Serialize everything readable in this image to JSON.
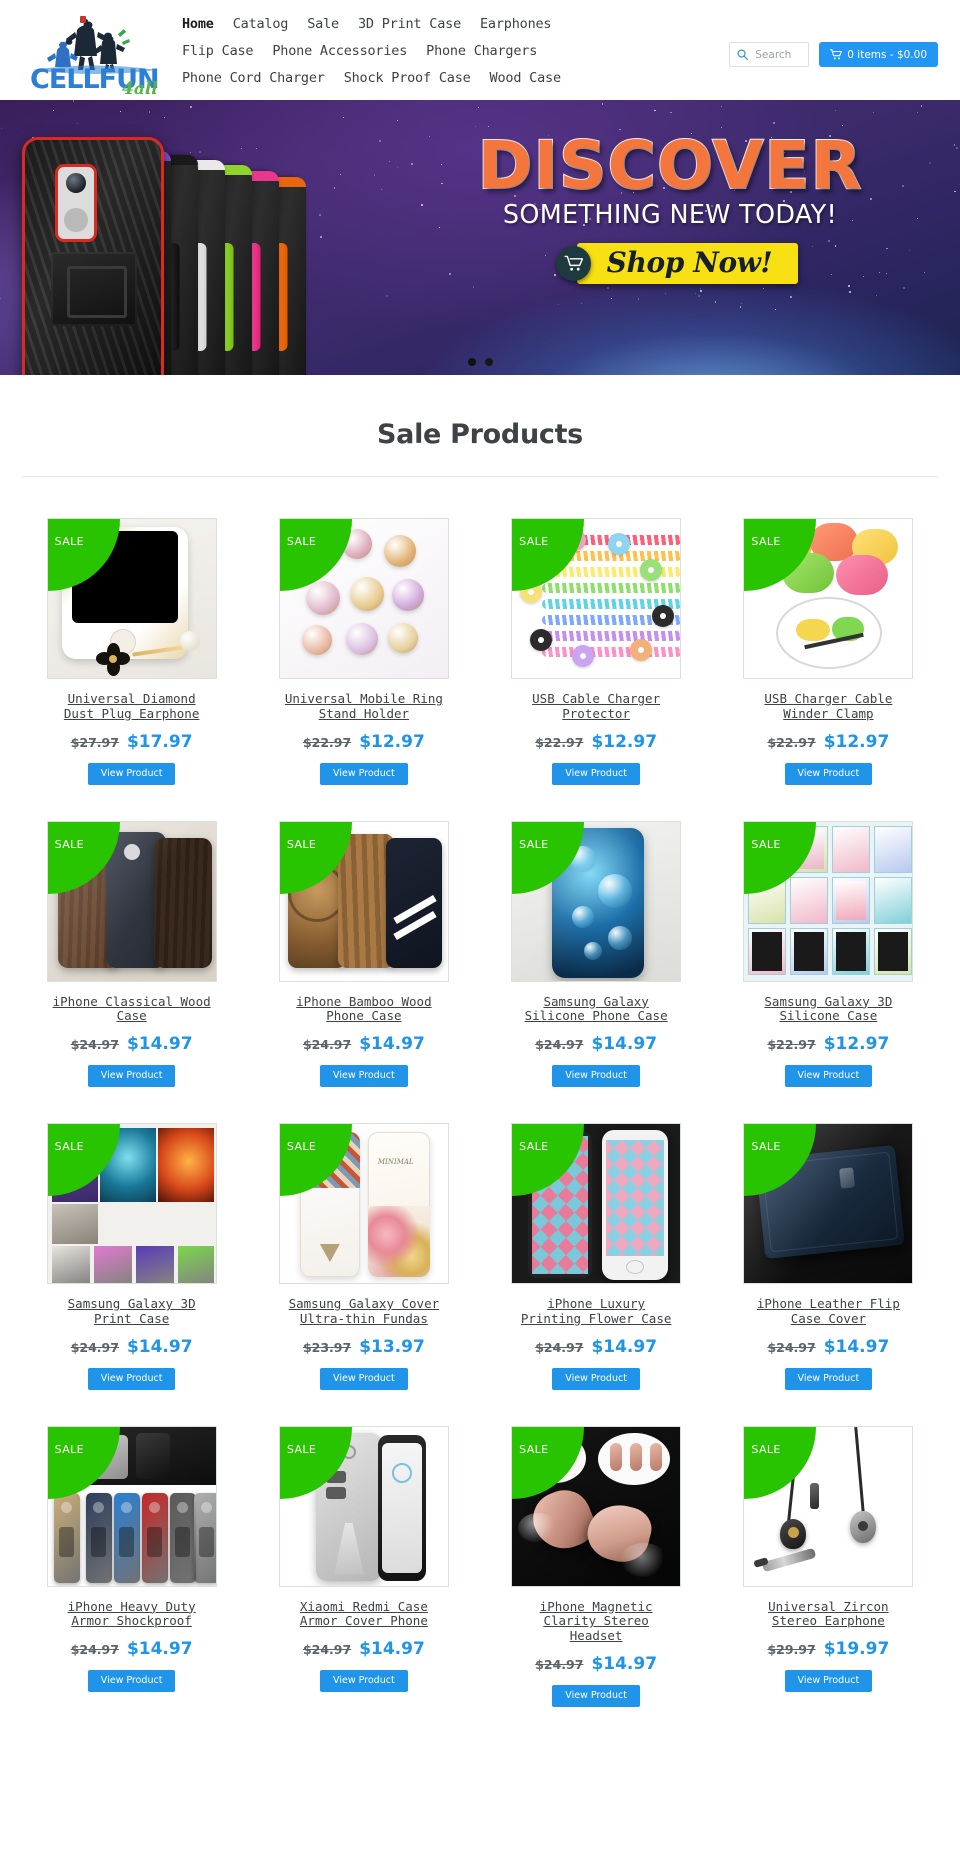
{
  "header": {
    "logo": {
      "brand_main": "CELLFUN",
      "brand_sub": "4all",
      "alt": "cellfun4all-logo"
    },
    "nav_rows": [
      [
        {
          "label": "Home",
          "active": true
        },
        {
          "label": "Catalog",
          "active": false
        },
        {
          "label": "Sale",
          "active": false
        },
        {
          "label": "3D Print Case",
          "active": false
        },
        {
          "label": "Earphones",
          "active": false
        }
      ],
      [
        {
          "label": "Flip Case",
          "active": false
        },
        {
          "label": "Phone Accessories",
          "active": false
        },
        {
          "label": "Phone Chargers",
          "active": false
        }
      ],
      [
        {
          "label": "Phone Cord Charger",
          "active": false
        },
        {
          "label": "Shock Proof Case",
          "active": false
        },
        {
          "label": "Wood Case",
          "active": false
        }
      ]
    ],
    "search": {
      "placeholder": "Search",
      "value": "",
      "icon": "search-icon"
    },
    "cart": {
      "label": "0 items - $0.00",
      "icon": "shopping-cart-icon",
      "count": 0,
      "total": "$0.00",
      "accent": "#2196f3"
    }
  },
  "hero": {
    "headline": "DISCOVER",
    "subhead": "SOMETHING NEW TODAY!",
    "cta_label": "Shop Now!",
    "cta_icon": "shopping-cart-icon",
    "headline_color": "#f4763c",
    "cta_bg": "#f7e014",
    "slides": 2,
    "active_slide": 1
  },
  "sale_section": {
    "title": "Sale Products",
    "view_label": "View Product",
    "badge_label": "SALE",
    "badge_color": "#29c400",
    "price_color": "#1f94e8",
    "products": [
      {
        "title": "Universal Diamond Dust Plug Earphone",
        "price_old": "$27.97",
        "price_new": "$17.97",
        "art": "dustplug"
      },
      {
        "title": "Universal Mobile Ring Stand Holder",
        "price_old": "$22.97",
        "price_new": "$12.97",
        "art": "ringholder"
      },
      {
        "title": "USB Cable Charger Protector",
        "price_old": "$22.97",
        "price_new": "$12.97",
        "art": "cableprotector"
      },
      {
        "title": "USB Charger Cable Winder Clamp",
        "price_old": "$22.97",
        "price_new": "$12.97",
        "art": "cablewinder"
      },
      {
        "title": "iPhone Classical Wood Case",
        "price_old": "$24.97",
        "price_new": "$14.97",
        "art": "woodcase"
      },
      {
        "title": "iPhone Bamboo Wood Phone Case",
        "price_old": "$24.97",
        "price_new": "$14.97",
        "art": "bamboocase"
      },
      {
        "title": "Samsung Galaxy Silicone Phone Case",
        "price_old": "$24.97",
        "price_new": "$14.97",
        "art": "silicone"
      },
      {
        "title": "Samsung Galaxy 3D Silicone Case",
        "price_old": "$22.97",
        "price_new": "$12.97",
        "art": "grid3d"
      },
      {
        "title": "Samsung Galaxy 3D Print Case",
        "price_old": "$24.97",
        "price_new": "$14.97",
        "art": "printcase"
      },
      {
        "title": "Samsung Galaxy Cover Ultra-thin Fundas",
        "price_old": "$23.97",
        "price_new": "$13.97",
        "art": "ultrathin"
      },
      {
        "title": "iPhone Luxury Printing Flower Case",
        "price_old": "$24.97",
        "price_new": "$14.97",
        "art": "flower"
      },
      {
        "title": "iPhone Leather Flip Case Cover",
        "price_old": "$24.97",
        "price_new": "$14.97",
        "art": "leather"
      },
      {
        "title": "iPhone Heavy Duty Armor Shockproof",
        "price_old": "$24.97",
        "price_new": "$14.97",
        "art": "armor"
      },
      {
        "title": "Xiaomi Redmi Case Armor Cover Phone",
        "price_old": "$24.97",
        "price_new": "$14.97",
        "art": "redmi"
      },
      {
        "title": "iPhone Magnetic Clarity Stereo Headset",
        "price_old": "$24.97",
        "price_new": "$14.97",
        "art": "headset"
      },
      {
        "title": "Universal Zircon Stereo Earphone",
        "price_old": "$29.97",
        "price_new": "$19.97",
        "art": "earphone"
      }
    ]
  }
}
